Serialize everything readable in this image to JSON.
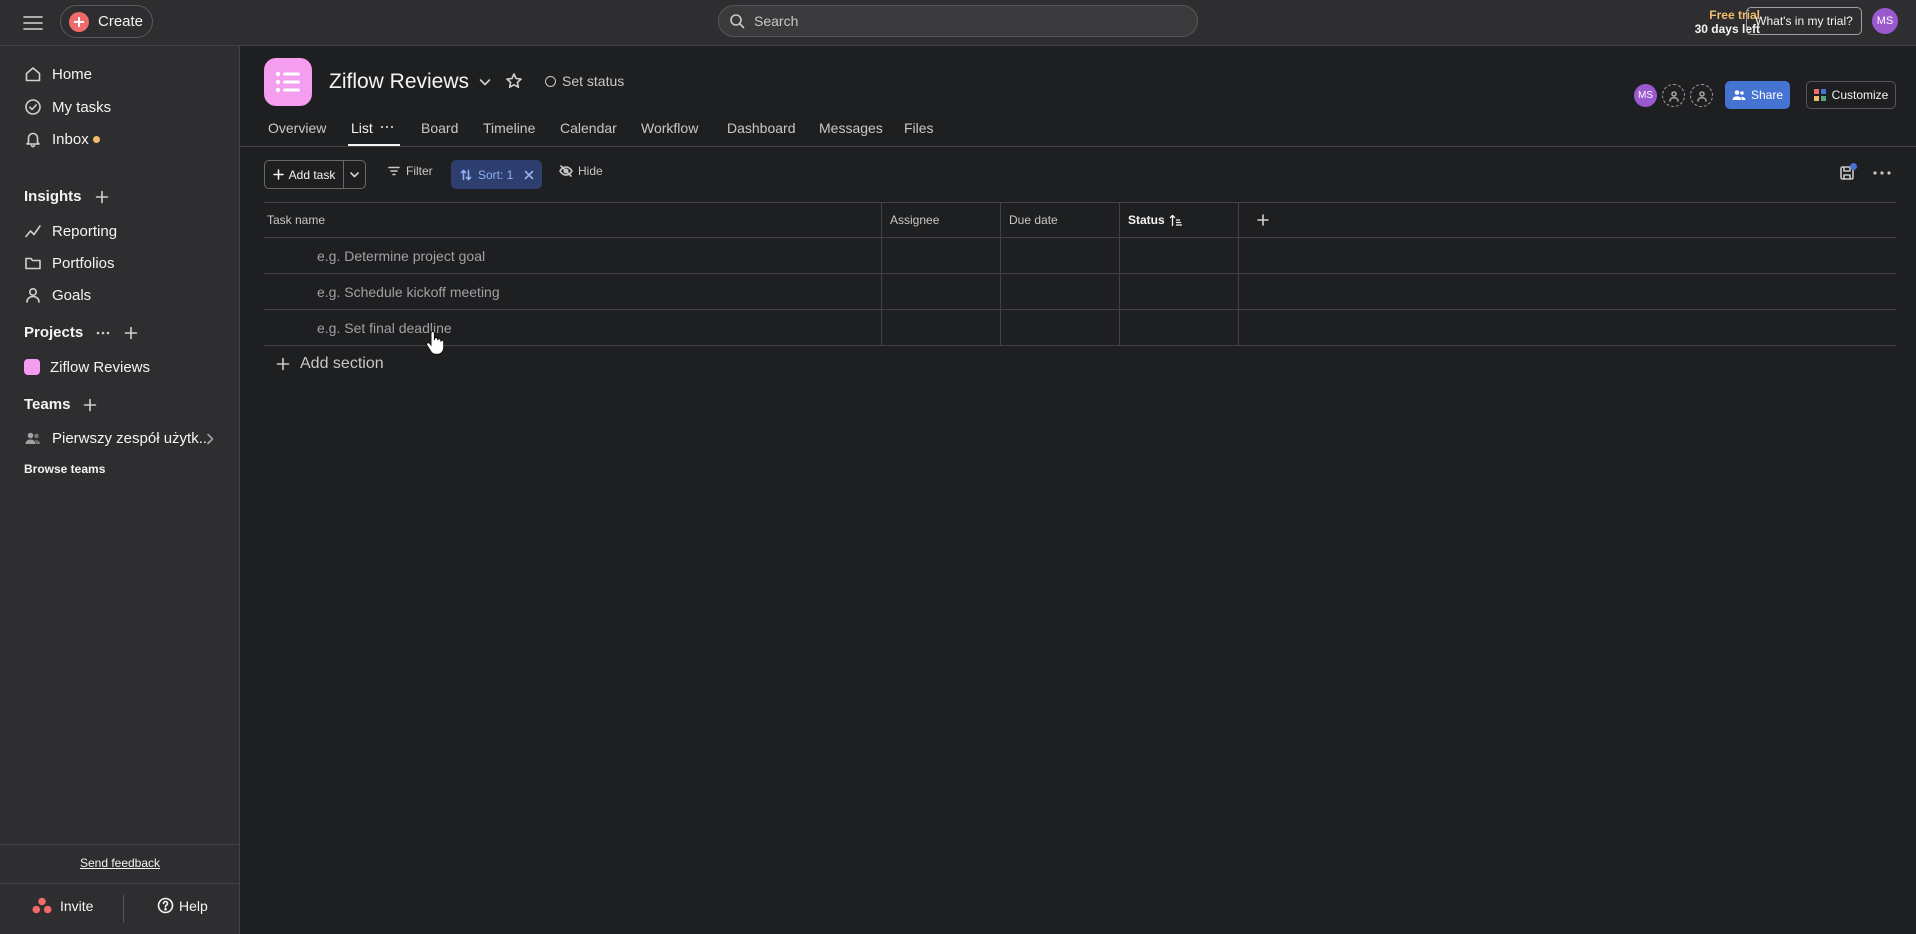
{
  "topbar": {
    "create_label": "Create",
    "search_placeholder": "Search",
    "trial_title": "Free trial",
    "trial_days": "30 days left",
    "trial_button": "What's in my trial?",
    "user_initials": "MS"
  },
  "sidebar": {
    "nav": [
      {
        "label": "Home",
        "icon": "home-icon"
      },
      {
        "label": "My tasks",
        "icon": "check-circle-icon"
      },
      {
        "label": "Inbox",
        "icon": "bell-icon"
      }
    ],
    "insights": {
      "heading": "Insights",
      "items": [
        {
          "label": "Reporting",
          "icon": "chart-line-icon"
        },
        {
          "label": "Portfolios",
          "icon": "folder-icon"
        },
        {
          "label": "Goals",
          "icon": "person-icon"
        }
      ]
    },
    "projects": {
      "heading": "Projects",
      "items": [
        {
          "label": "Ziflow Reviews",
          "color": "#f59ef0"
        }
      ]
    },
    "teams": {
      "heading": "Teams",
      "items": [
        {
          "label": "Pierwszy zespół użytk..."
        }
      ],
      "browse": "Browse teams"
    },
    "footer": {
      "feedback": "Send feedback",
      "invite": "Invite",
      "help": "Help"
    }
  },
  "project": {
    "title": "Ziflow Reviews",
    "set_status": "Set status",
    "member_initials": "MS",
    "share_label": "Share",
    "customize_label": "Customize",
    "accent_color": "#f59ef0",
    "share_color": "#4573d2"
  },
  "tabs": [
    {
      "label": "Overview"
    },
    {
      "label": "List",
      "active": true
    },
    {
      "label": "Board"
    },
    {
      "label": "Timeline"
    },
    {
      "label": "Calendar"
    },
    {
      "label": "Workflow"
    },
    {
      "label": "Dashboard"
    },
    {
      "label": "Messages"
    },
    {
      "label": "Files"
    }
  ],
  "toolbar": {
    "add_task": "Add task",
    "filter": "Filter",
    "sort": "Sort: 1",
    "hide": "Hide"
  },
  "table": {
    "columns": [
      "Task name",
      "Assignee",
      "Due date",
      "Status"
    ],
    "rows": [
      {
        "task": "e.g. Determine project goal"
      },
      {
        "task": "e.g. Schedule kickoff meeting"
      },
      {
        "task": "e.g. Set final deadline"
      }
    ],
    "add_section": "Add section"
  }
}
